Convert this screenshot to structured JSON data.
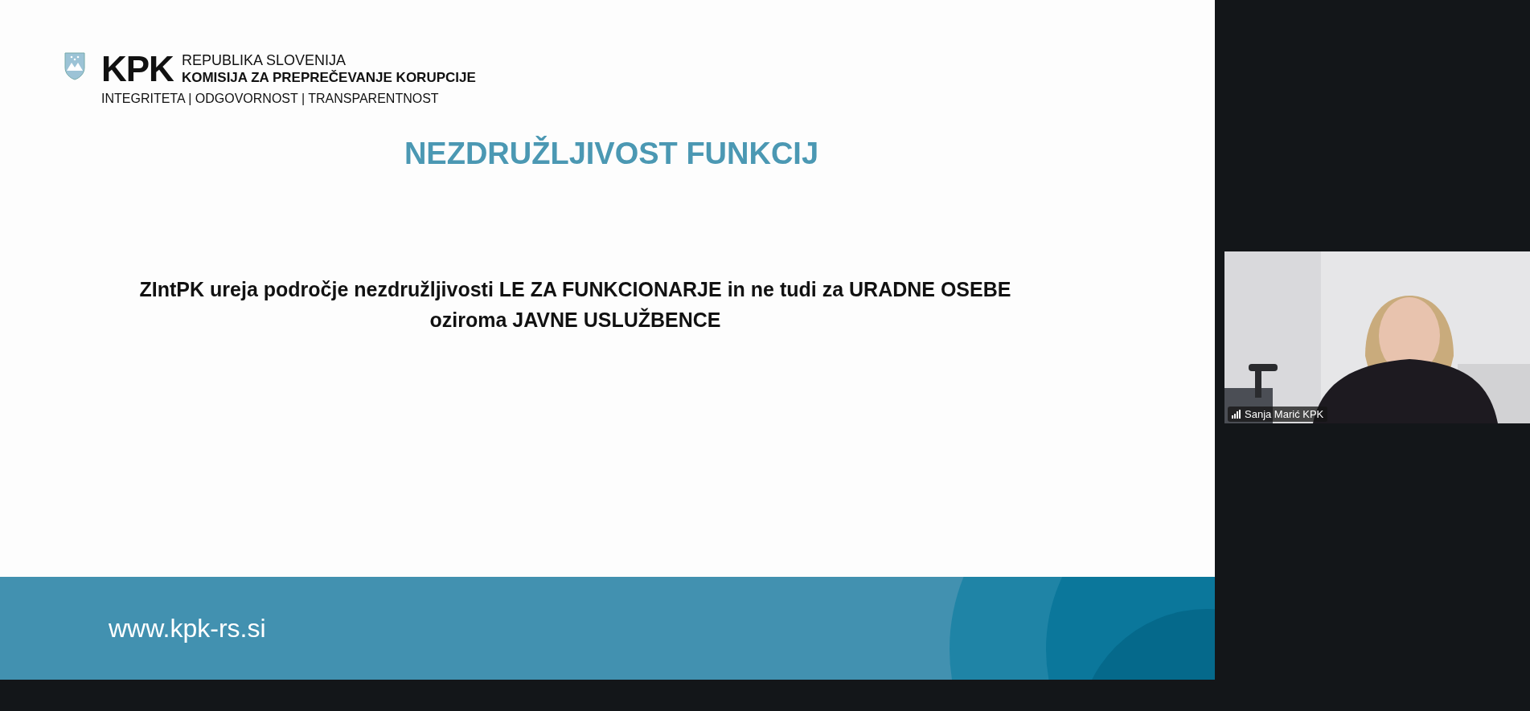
{
  "slide": {
    "logo": {
      "acronym": "KPK",
      "line_1": "REPUBLIKA SLOVENIJA",
      "line_2": "KOMISIJA ZA PREPREČEVANJE KORUPCIJE",
      "tagline": "INTEGRITETA | ODGOVORNOST | TRANSPARENTNOST"
    },
    "title": "NEZDRUŽLJIVOST FUNKCIJ",
    "body": "ZIntPK ureja področje nezdružljivosti LE ZA FUNKCIONARJE in ne tudi za URADNE OSEBE\noziroma JAVNE USLUŽBENCE",
    "footer": "www.kpk-rs.si"
  },
  "participant": {
    "name": "Sanja Marić KPK"
  }
}
